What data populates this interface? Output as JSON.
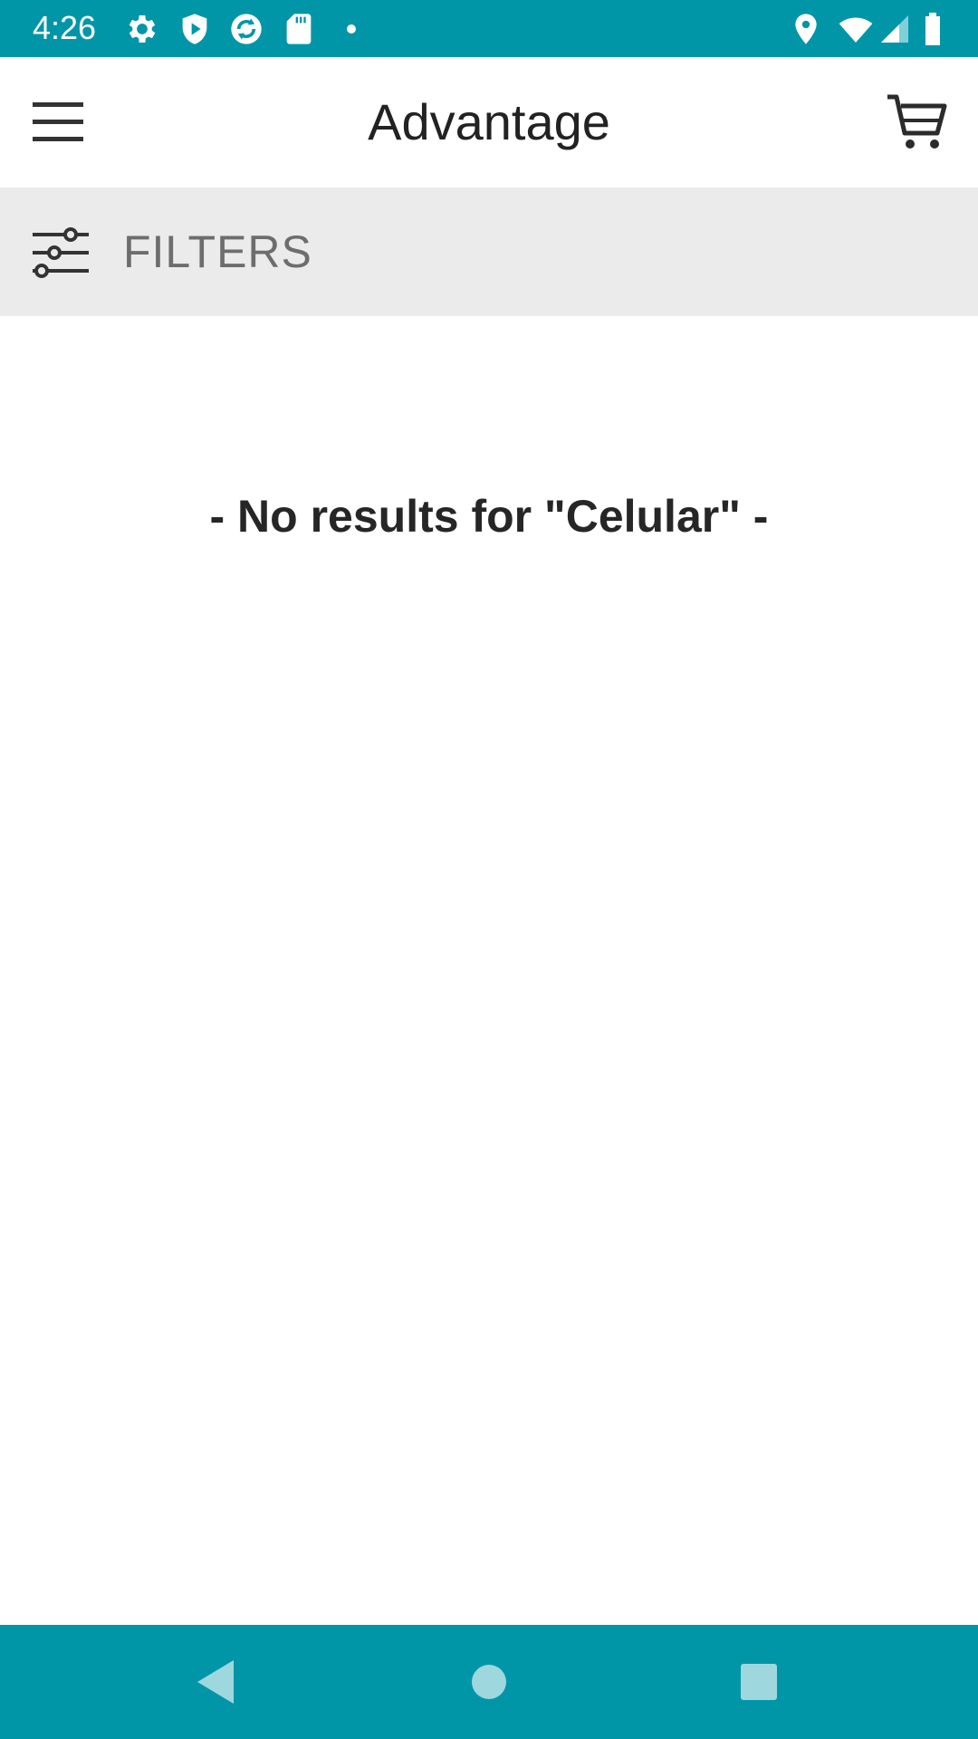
{
  "status_bar": {
    "time": "4:26",
    "left_icons": [
      "settings-icon",
      "play-protect-icon",
      "sync-icon",
      "sd-card-icon",
      "notification-dot-icon"
    ],
    "right_icons": [
      "location-icon",
      "wifi-icon",
      "cellular-signal-icon",
      "battery-icon"
    ],
    "background_color": "#0096a8"
  },
  "app_bar": {
    "title": "Advantage",
    "menu_icon": "hamburger-menu-icon",
    "cart_icon": "shopping-cart-icon"
  },
  "filters": {
    "label": "FILTERS",
    "icon": "sliders-icon"
  },
  "main": {
    "message": "- No results for \"Celular\" -"
  },
  "nav_bar": {
    "buttons": [
      "back-icon",
      "home-icon",
      "recents-icon"
    ],
    "background_color": "#0096a8"
  }
}
